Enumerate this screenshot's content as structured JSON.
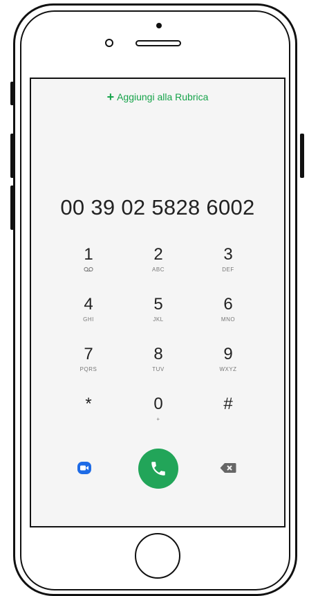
{
  "header": {
    "add_contact_label": "Aggiungi alla Rubrica"
  },
  "display": {
    "number": "00 39 02 5828 6002"
  },
  "keypad": [
    {
      "digit": "1",
      "letters": ""
    },
    {
      "digit": "2",
      "letters": "ABC"
    },
    {
      "digit": "3",
      "letters": "DEF"
    },
    {
      "digit": "4",
      "letters": "GHI"
    },
    {
      "digit": "5",
      "letters": "JKL"
    },
    {
      "digit": "6",
      "letters": "MNO"
    },
    {
      "digit": "7",
      "letters": "PQRS"
    },
    {
      "digit": "8",
      "letters": "TUV"
    },
    {
      "digit": "9",
      "letters": "WXYZ"
    },
    {
      "digit": "*",
      "letters": ""
    },
    {
      "digit": "0",
      "letters": "+"
    },
    {
      "digit": "#",
      "letters": ""
    }
  ],
  "icons": {
    "add": "plus-icon",
    "voicemail": "voicemail-icon",
    "video_call": "video-call-icon",
    "call": "phone-icon",
    "backspace": "backspace-icon"
  },
  "colors": {
    "accent_green": "#16a34a",
    "call_button": "#22a559",
    "video_button": "#1e6be6",
    "backspace": "#666666"
  }
}
